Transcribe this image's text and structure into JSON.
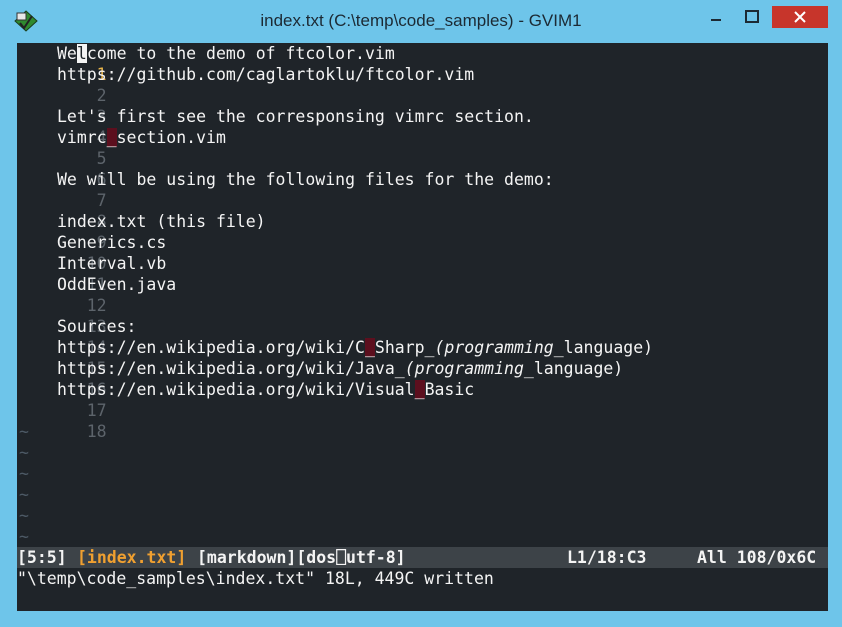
{
  "window": {
    "title": "index.txt (C:\\temp\\code_samples) - GVIM1"
  },
  "colors": {
    "titlebar": "#6ec5ea",
    "editor_bg": "#1f2429",
    "line_number": "#5d646b",
    "current_line_number": "#e8b44a",
    "text": "#f4f4f4",
    "statusline_bg": "#3d4348",
    "statusline_filename": "#f0a030",
    "close_button": "#c7352b"
  },
  "icons": {
    "app": "gvim-icon",
    "minimize": "minimize-icon",
    "maximize": "maximize-icon",
    "close": "close-icon"
  },
  "editor": {
    "lines": [
      {
        "num": "1",
        "text": "Welcome to the demo of ftcolor.vim"
      },
      {
        "num": "2",
        "text": "https://github.com/caglartoklu/ftcolor.vim"
      },
      {
        "num": "3",
        "text": ""
      },
      {
        "num": "4",
        "text": "Let's first see the corresponsing vimrc section."
      },
      {
        "num": "5",
        "text": "vimrc_section.vim"
      },
      {
        "num": "6",
        "text": ""
      },
      {
        "num": "7",
        "text": "We will be using the following files for the demo:"
      },
      {
        "num": "8",
        "text": ""
      },
      {
        "num": "9",
        "text": "index.txt (this file)"
      },
      {
        "num": "10",
        "text": "Generics.cs"
      },
      {
        "num": "11",
        "text": "Interval.vb"
      },
      {
        "num": "12",
        "text": "OddEven.java"
      },
      {
        "num": "13",
        "text": ""
      },
      {
        "num": "14",
        "text": "Sources:"
      },
      {
        "num": "15",
        "text": "https://en.wikipedia.org/wiki/C_Sharp_(programming_language)"
      },
      {
        "num": "16",
        "text": "https://en.wikipedia.org/wiki/Java_(programming_language)"
      },
      {
        "num": "17",
        "text": "https://en.wikipedia.org/wiki/Visual_Basic"
      },
      {
        "num": "18",
        "text": ""
      }
    ],
    "line1": {
      "pre": "We",
      "cursor": "l",
      "post": "come to the demo of ftcolor.vim"
    },
    "line5": {
      "pre": "vimrc",
      "mark": "_",
      "post": "section.vim"
    },
    "line15": {
      "a": "https://en.wikipedia.org/wiki/C",
      "mark": "_",
      "b": "Sharp_",
      "c": "(programming",
      "d": "_language)"
    },
    "line16": {
      "a": "https://en.wikipedia.org/wiki/Java_",
      "c": "(programming",
      "d": "_language)"
    },
    "line17": {
      "a": "https://en.wikipedia.org/wiki/Visual",
      "mark": "_",
      "b": "Basic"
    },
    "tilde": "~"
  },
  "statusline": {
    "position": "[5:5]",
    "filename": "[index.txt]",
    "meta": "[markdown][dos⎕utf-8]",
    "line_col": "L1/18:C3",
    "byte_info": "All 108/0x6C"
  },
  "cmdline": {
    "message": "\"\\temp\\code_samples\\index.txt\" 18L, 449C written"
  }
}
